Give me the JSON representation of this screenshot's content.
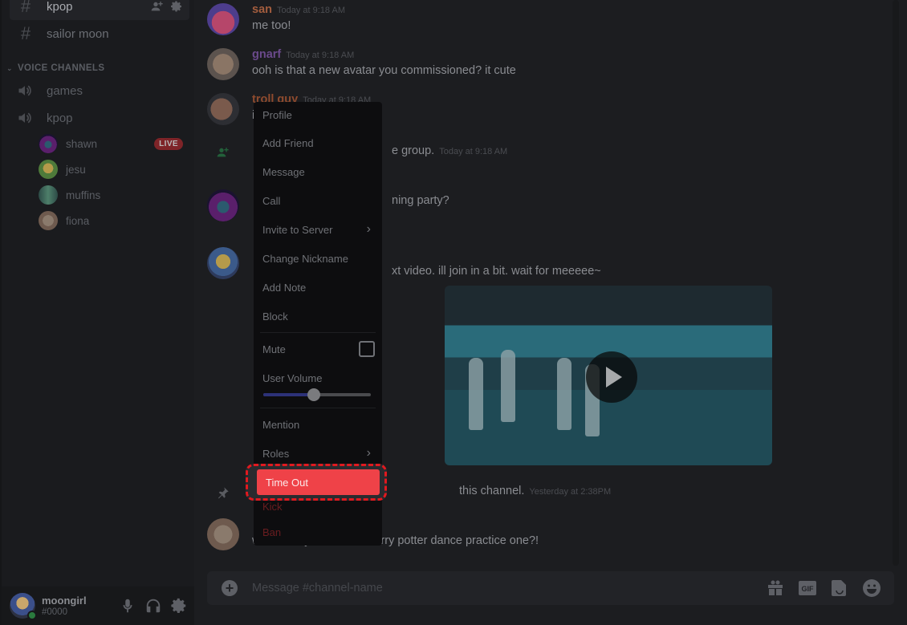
{
  "sidebar": {
    "text_channels": [
      {
        "name": "kpop",
        "active": true
      },
      {
        "name": "sailor moon",
        "active": false
      }
    ],
    "voice_category": "VOICE CHANNELS",
    "voice_channels": [
      {
        "name": "games"
      },
      {
        "name": "kpop"
      }
    ],
    "voice_users": [
      {
        "name": "shawn",
        "badge": "LIVE"
      },
      {
        "name": "jesu"
      },
      {
        "name": "muffins"
      },
      {
        "name": "fiona"
      }
    ]
  },
  "user_panel": {
    "username": "moongirl",
    "tag": "#0000",
    "status": "online"
  },
  "messages": [
    {
      "author": "san",
      "time": "Today at 9:18 AM",
      "text": "me too!",
      "color": "#a35d3e"
    },
    {
      "author": "gnarf",
      "time": "Today at 9:18 AM",
      "text": "ooh is that a new avatar you commissioned? it cute",
      "color": "#6b4a8c"
    },
    {
      "author": "troll guy",
      "time": "Today at 9:18 AM",
      "text": "i",
      "color": "#8f4b2e"
    },
    {
      "system_text_visible": "e group.",
      "time": "Today at 9:18 AM"
    },
    {
      "text_visible": "ning party?"
    },
    {
      "text_visible": "xt video. ill join in a bit. wait for meeeee~"
    },
    {
      "system_text_visible": "this channel.",
      "time": "Yesterday at 2:38PM"
    },
    {
      "text_visible": "wait have you see the harry potter dance practice one?!"
    }
  ],
  "composer": {
    "placeholder": "Message #channel-name",
    "gif_label": "GIF"
  },
  "context_menu": {
    "items": [
      {
        "label": "Profile"
      },
      {
        "label": "Add Friend"
      },
      {
        "label": "Message"
      },
      {
        "label": "Call"
      },
      {
        "label": "Invite to Server",
        "submenu": true
      },
      {
        "label": "Change Nickname"
      },
      {
        "label": "Add Note"
      },
      {
        "label": "Block"
      }
    ],
    "mute_label": "Mute",
    "mute_checked": false,
    "volume_label": "User Volume",
    "volume_fraction": 0.47,
    "mention_label": "Mention",
    "roles_label": "Roles",
    "timeout_label": "Time Out",
    "kick_label": "Kick",
    "ban_label": "Ban"
  },
  "colors": {
    "accent_blurple": "#2c3178",
    "danger": "#ef4248",
    "highlight_outline": "#e1191f",
    "online": "#2a7a3e"
  }
}
